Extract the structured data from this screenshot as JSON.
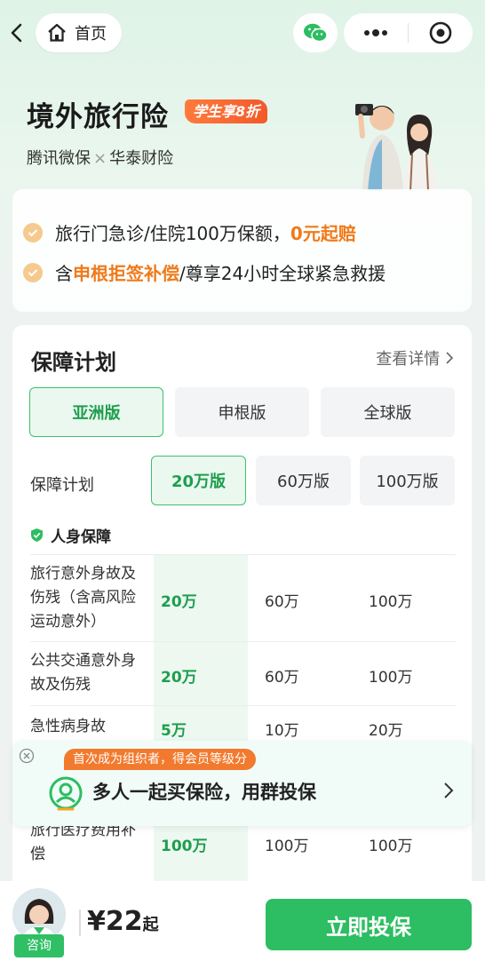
{
  "nav": {
    "home_label": "首页"
  },
  "hero": {
    "title": "境外旅行险",
    "discount_badge": "学生享8折",
    "partner_a": "腾讯微保",
    "partner_sep": "×",
    "partner_b": "华泰财险"
  },
  "benefits": [
    {
      "text_a": "旅行门急诊/住院100万保额，",
      "highlight": "0元起赔",
      "text_b": ""
    },
    {
      "text_a": "含",
      "highlight": "申根拒签补偿",
      "text_b": "/尊享24小时全球紧急救援"
    }
  ],
  "plan": {
    "title": "保障计划",
    "detail_link": "查看详情",
    "versions": [
      "亚洲版",
      "申根版",
      "全球版"
    ],
    "selected_version": "亚洲版",
    "tier_label": "保障计划",
    "tiers": [
      "20万版",
      "60万版",
      "100万版"
    ],
    "selected_tier": "20万版",
    "section_title": "人身保障",
    "rows": [
      {
        "name": "旅行意外身故及伤残（含高风险运动意外）",
        "values": [
          "20万",
          "60万",
          "100万"
        ]
      },
      {
        "name": "公共交通意外身故及伤残",
        "values": [
          "20万",
          "60万",
          "100万"
        ]
      },
      {
        "name": "急性病身故",
        "values": [
          "5万",
          "10万",
          "20万"
        ]
      },
      {
        "name": "旅行医疗费用补偿",
        "values": [
          "100万",
          "100万",
          "100万"
        ]
      }
    ]
  },
  "group_banner": {
    "tag": "首次成为组织者，得会员等级分",
    "text": "多人一起买保险，用群投保"
  },
  "bottom": {
    "consult_label": "咨询",
    "price": "¥22",
    "price_unit": "起",
    "buy_label": "立即投保"
  },
  "colors": {
    "brand_green": "#2dbd62",
    "highlight_orange": "#f07a1a",
    "badge_orange": "#f25a2a"
  }
}
